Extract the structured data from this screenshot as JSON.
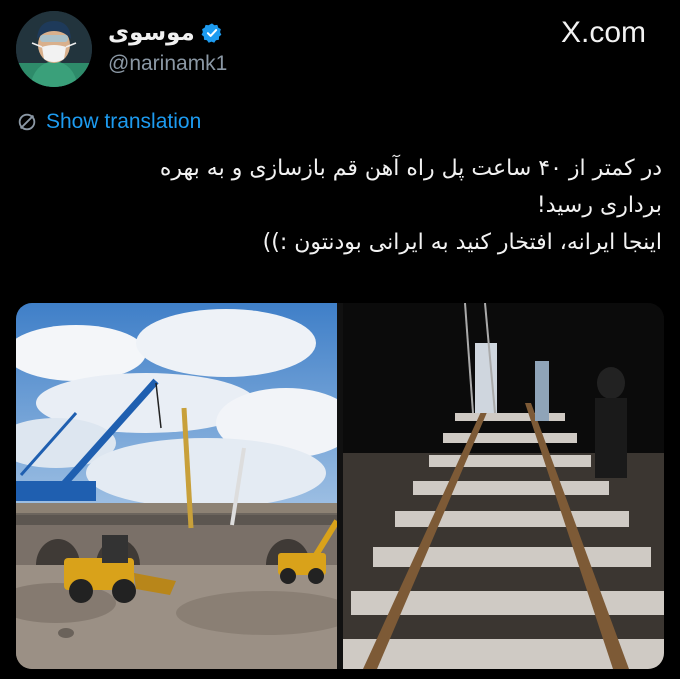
{
  "header": {
    "display_name": "موسوی",
    "handle": "@narinamk1",
    "site_label": "X.com",
    "verified": true
  },
  "translation": {
    "label": "Show translation"
  },
  "tweet": {
    "lines": [
      "در کمتر از ۴۰ ساعت پل راه آهن قم بازسازی و به بهره",
      "برداری رسید!",
      "اینجا ایرانه، افتخار کنید به ایرانی بودنتون :))"
    ]
  },
  "media": {
    "images": [
      {
        "subject": "bridge reconstruction site with cranes and loaders"
      },
      {
        "subject": "new railway track with concrete sleepers at night"
      }
    ]
  },
  "colors": {
    "background": "#000000",
    "accent": "#1d9bf0",
    "secondary_text": "#8b98a5"
  }
}
